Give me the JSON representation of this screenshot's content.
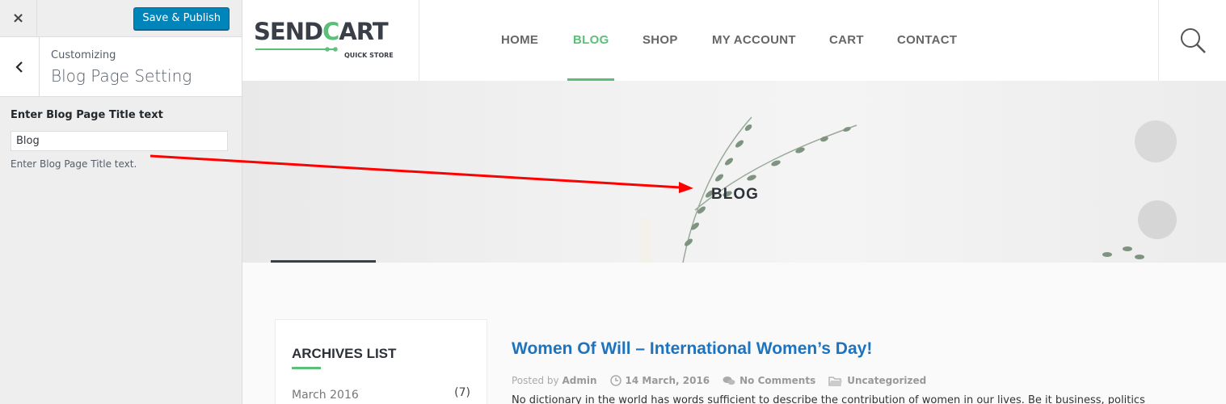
{
  "customizer": {
    "close_label": "×",
    "save_label": "Save & Publish",
    "breadcrumb": "Customizing",
    "section_title": "Blog Page Setting",
    "field_label": "Enter Blog Page Title text",
    "field_value": "Blog",
    "field_description": "Enter Blog Page Title text."
  },
  "site": {
    "logo_text_a": "SEND",
    "logo_text_b": "C",
    "logo_text_c": "ART",
    "logo_tagline": "QUICK STORE",
    "nav": [
      {
        "label": "HOME",
        "active": false
      },
      {
        "label": "BLOG",
        "active": true
      },
      {
        "label": "SHOP",
        "active": false
      },
      {
        "label": "MY ACCOUNT",
        "active": false
      },
      {
        "label": "CART",
        "active": false
      },
      {
        "label": "CONTACT",
        "active": false
      }
    ],
    "accent_color": "#5bbf7a",
    "link_color": "#1e73be"
  },
  "hero": {
    "title": "BLOG"
  },
  "archives": {
    "title": "ARCHIVES LIST",
    "items": [
      {
        "month": "March 2016",
        "count": "(7)"
      }
    ]
  },
  "post": {
    "title": "Women Of Will – International Women’s Day!",
    "posted_by_label": "Posted by",
    "author": "Admin",
    "date": "14 March, 2016",
    "comments": "No Comments",
    "category": "Uncategorized",
    "excerpt": "No dictionary in the world has words sufficient to describe the contribution of women in our lives. Be it business, politics"
  },
  "annotation_color": "#ff0000"
}
